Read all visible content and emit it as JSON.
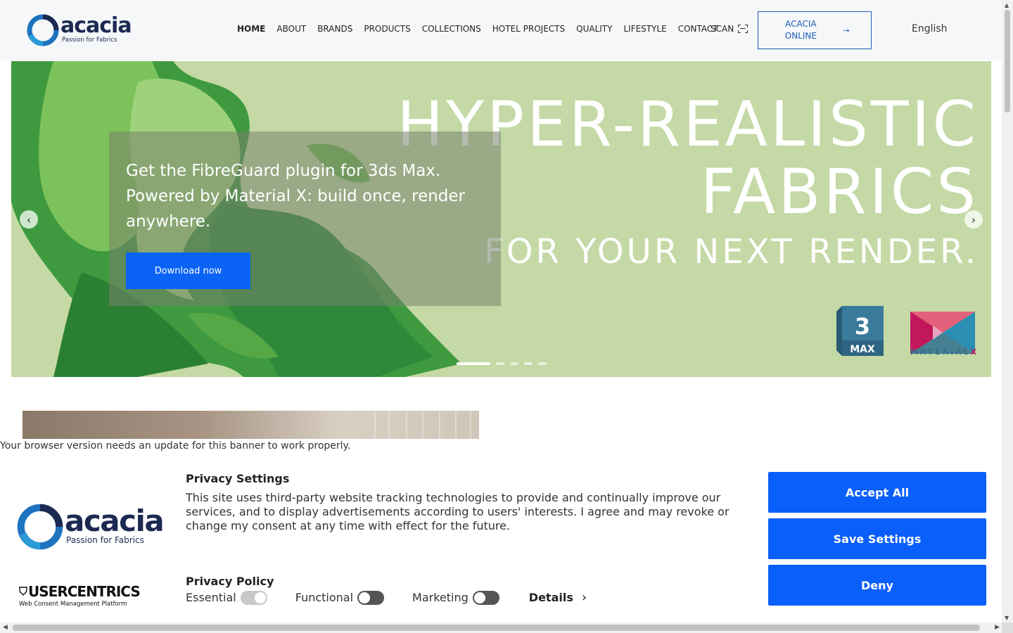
{
  "header": {
    "logo": {
      "word": "acacia",
      "tagline": "Passion for Fabrics"
    },
    "nav": [
      "HOME",
      "ABOUT",
      "BRANDS",
      "PRODUCTS",
      "COLLECTIONS",
      "HOTEL PROJECTS",
      "QUALITY",
      "LIFESTYLE",
      "CONTACT"
    ],
    "active_nav": "HOME",
    "scan_label": "SCAN",
    "online_button": {
      "label": "ACACIA ONLINE",
      "arrow": "→"
    },
    "language": "English"
  },
  "hero": {
    "headline_line1": "HYPER-REALISTIC",
    "headline_line2": "FABRICS",
    "headline_line3": "FOR YOUR NEXT RENDER.",
    "promo_text": "Get the FibreGuard plugin for 3ds Max. Powered by Material X: build once, render anywhere.",
    "cta_label": "Download now",
    "prev_arrow": "‹",
    "next_arrow": "›",
    "slide_count": 5,
    "active_slide": 1,
    "badges": {
      "max_number": "3",
      "max_label": "MAX",
      "materialx_prefix": "MATERIAL",
      "materialx_suffix": "X"
    },
    "colors": {
      "background": "#c4d9a5",
      "cta": "#0a63f5"
    }
  },
  "consent": {
    "update_notice": "Your browser version needs an update for this banner to work properly.",
    "logo": {
      "word": "acacia",
      "tagline": "Passion for Fabrics"
    },
    "provider": {
      "name": "USERCENTRICS",
      "subtitle": "Web Consent Management Platform"
    },
    "title": "Privacy Settings",
    "body": "This site uses third-party website tracking technologies to provide and continually improve our services, and to display advertisements according to users' interests. I agree and may revoke or change my consent at any time with effect for the future.",
    "policy_title": "Privacy Policy",
    "categories": [
      {
        "label": "Essential",
        "state": "on"
      },
      {
        "label": "Functional",
        "state": "off"
      },
      {
        "label": "Marketing",
        "state": "off"
      }
    ],
    "details_label": "Details",
    "buttons": {
      "accept": "Accept All",
      "save": "Save Settings",
      "deny": "Deny"
    },
    "colors": {
      "button": "#0a5ffb"
    }
  }
}
